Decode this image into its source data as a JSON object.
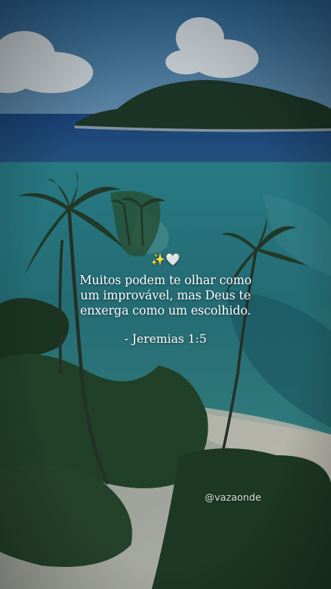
{
  "post": {
    "emoji": {
      "sparkles": "✨",
      "heart": "🤍"
    },
    "quote_lines": [
      "Muitos podem te olhar como",
      "um improvável, mas Deus te",
      "enxerga como um escolhido."
    ],
    "reference": "- Jeremias 1:5",
    "watermark": "@vazaonde"
  },
  "colors": {
    "sky": "#3a6fa0",
    "ocean_deep": "#1f4f86",
    "lagoon": "#2a8c94",
    "sand": "#cfc8bb",
    "foliage": "#1e3a22"
  }
}
